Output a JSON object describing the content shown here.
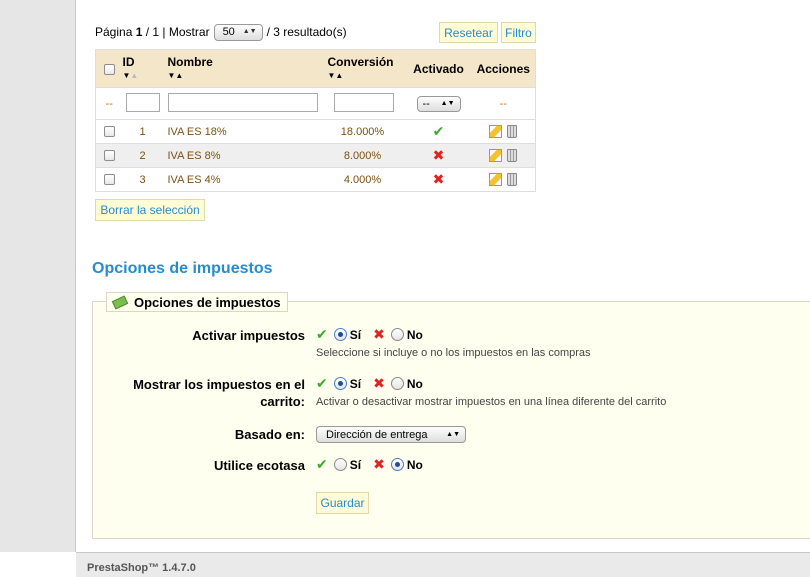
{
  "pagination": {
    "page_label": "Página",
    "current": "1",
    "separator": "/ 1 |",
    "show_label": "Mostrar",
    "per_page": "50",
    "results": "/ 3 resultado(s)"
  },
  "buttons": {
    "reset": "Resetear",
    "filter": "Filtro",
    "delete_selection": "Borrar la selección",
    "save": "Guardar"
  },
  "table": {
    "columns": [
      "ID",
      "Nombre",
      "Conversión",
      "Activado",
      "Acciones"
    ],
    "filter_placeholder": "--",
    "filter_select": "--",
    "rows": [
      {
        "id": "1",
        "name": "IVA ES 18%",
        "rate": "18.000%",
        "active": true
      },
      {
        "id": "2",
        "name": "IVA ES 8%",
        "rate": "8.000%",
        "active": false
      },
      {
        "id": "3",
        "name": "IVA ES 4%",
        "rate": "4.000%",
        "active": false
      }
    ]
  },
  "section": {
    "title": "Opciones de impuestos",
    "legend": "Opciones de impuestos"
  },
  "options": {
    "enable_tax": {
      "label": "Activar impuestos",
      "yes": "Sí",
      "no": "No",
      "selected": "yes",
      "hint": "Seleccione si incluye o no los impuestos en las compras"
    },
    "show_tax_cart": {
      "label_line1": "Mostrar los impuestos en el",
      "label_line2": "carrito:",
      "yes": "Sí",
      "no": "No",
      "selected": "yes",
      "hint": "Activar o desactivar mostrar impuestos en una línea diferente del carrito"
    },
    "based_on": {
      "label": "Basado en:",
      "value": "Dirección de entrega"
    },
    "ecotax": {
      "label": "Utilice ecotasa",
      "yes": "Sí",
      "no": "No",
      "selected": "no"
    }
  },
  "footer": {
    "version": "PrestaShop™ 1.4.7.0"
  },
  "colors": {
    "accent": "#268ccd",
    "header_bg": "#f4e6c9",
    "panel_bg": "#fffff0"
  }
}
